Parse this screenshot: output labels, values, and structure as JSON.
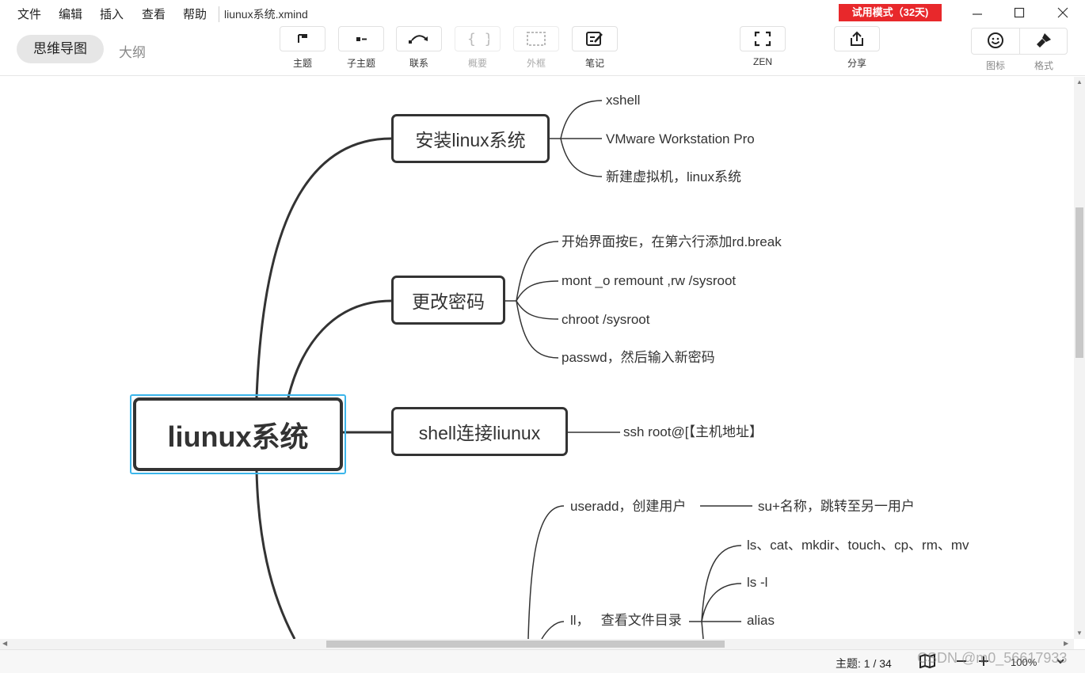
{
  "menu": {
    "items": [
      "文件",
      "编辑",
      "插入",
      "查看",
      "帮助"
    ],
    "file_title": "liunux系统.xmind",
    "trial_badge": "试用模式（32天)"
  },
  "toolbar": {
    "view_mindmap": "思维导图",
    "view_outline": "大纲",
    "tools": [
      {
        "label": "主题",
        "icon": "topic-icon"
      },
      {
        "label": "子主题",
        "icon": "subtopic-icon"
      },
      {
        "label": "联系",
        "icon": "relationship-icon"
      },
      {
        "label": "概要",
        "icon": "summary-icon",
        "disabled": true
      },
      {
        "label": "外框",
        "icon": "boundary-icon",
        "disabled": true
      },
      {
        "label": "笔记",
        "icon": "note-icon"
      },
      {
        "label": "ZEN",
        "icon": "zen-fullscreen-icon"
      },
      {
        "label": "分享",
        "icon": "share-icon"
      }
    ],
    "icon_panel_label": "图标",
    "format_panel_label": "格式"
  },
  "mindmap": {
    "central": "liunux系统",
    "branches": [
      {
        "title": "安装linux系统",
        "children": [
          "xshell",
          "VMware Workstation Pro",
          "新建虚拟机，linux系统"
        ]
      },
      {
        "title": "更改密码",
        "children": [
          "开始界面按E，在第六行添加rd.break",
          "mont  _o remount ,rw /sysroot",
          "chroot /sysroot",
          "passwd，然后输入新密码"
        ]
      },
      {
        "title": "shell连接liunux",
        "children": [
          "ssh root@[【主机地址】"
        ]
      },
      {
        "title": "",
        "children": [
          {
            "label": "useradd，创建用户",
            "children": [
              "su+名称，跳转至另一用户"
            ]
          },
          {
            "label": "ll，   查看文件目录",
            "children": [
              "ls、cat、mkdir、touch、cp、rm、mv",
              "ls -l",
              "alias"
            ]
          }
        ]
      }
    ]
  },
  "status": {
    "topic_count": "主题: 1 / 34",
    "zoom": "100%",
    "watermark": "CSDN @m0_56617933"
  },
  "colors": {
    "trial_bg": "#e8282b",
    "selection": "#3bb5ea",
    "node_border": "#333333"
  }
}
